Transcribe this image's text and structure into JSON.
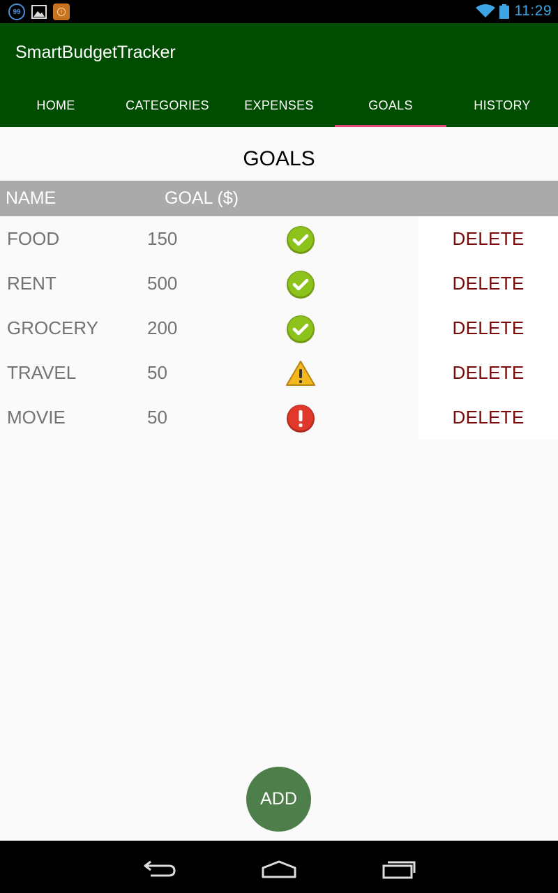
{
  "status_bar": {
    "notification_count": "99",
    "time": "11:29",
    "icons": [
      "notification-count-icon",
      "gallery-icon",
      "app-notification-icon",
      "wifi-icon",
      "battery-icon"
    ]
  },
  "app_bar": {
    "title": "SmartBudgetTracker",
    "background_color": "#004c00",
    "tabs": [
      {
        "label": "HOME",
        "active": false
      },
      {
        "label": "CATEGORIES",
        "active": false
      },
      {
        "label": "EXPENSES",
        "active": false
      },
      {
        "label": "GOALS",
        "active": true
      },
      {
        "label": "HISTORY",
        "active": false
      }
    ],
    "active_indicator_color": "#e0467a"
  },
  "page": {
    "title": "GOALS",
    "table": {
      "columns": [
        "NAME",
        "GOAL ($)"
      ],
      "rows": [
        {
          "name": "FOOD",
          "goal": "150",
          "status": "ok",
          "delete_label": "DELETE"
        },
        {
          "name": "RENT",
          "goal": "500",
          "status": "ok",
          "delete_label": "DELETE"
        },
        {
          "name": "GROCERY",
          "goal": "200",
          "status": "ok",
          "delete_label": "DELETE"
        },
        {
          "name": "TRAVEL",
          "goal": "50",
          "status": "warning",
          "delete_label": "DELETE"
        },
        {
          "name": "MOVIE",
          "goal": "50",
          "status": "error",
          "delete_label": "DELETE"
        }
      ]
    },
    "status_colors": {
      "ok": "#8cc21a",
      "warning": "#f2b81d",
      "error": "#e0392c"
    },
    "delete_color": "#7a0a0a"
  },
  "fab": {
    "label": "ADD",
    "color": "#4e7e4a"
  },
  "nav_bar": {
    "buttons": [
      "back-icon",
      "home-icon",
      "recent-apps-icon"
    ]
  }
}
